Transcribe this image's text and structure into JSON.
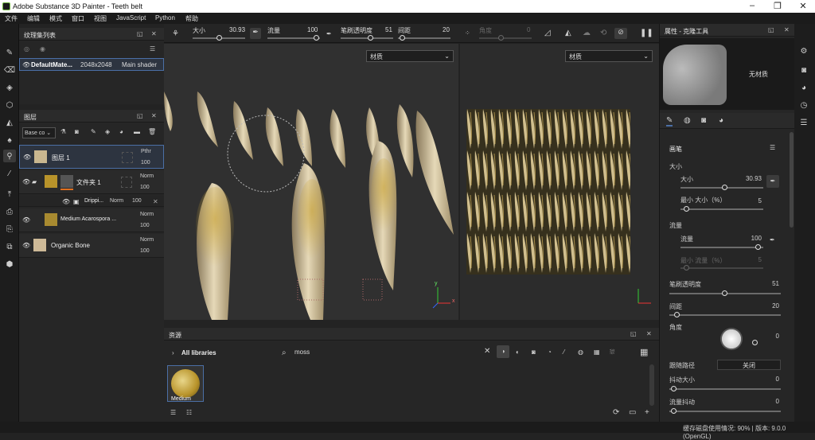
{
  "window": {
    "title": "Adobe Substance 3D Painter - Teeth belt"
  },
  "menu": [
    "文件",
    "编辑",
    "模式",
    "窗口",
    "视图",
    "JavaScript",
    "Python",
    "帮助"
  ],
  "texture_set": {
    "title": "纹理集列表",
    "item": {
      "name": "DefaultMate...",
      "res": "2048x2048",
      "shader": "Main shader"
    }
  },
  "layers": {
    "title": "图层",
    "channel": "Base co",
    "items": [
      {
        "name": "图层 1",
        "blend": "Pthr",
        "opacity": "100"
      },
      {
        "name": "文件夹 1",
        "blend": "Norm",
        "opacity": "100"
      },
      {
        "name": "Drippi...",
        "blend": "Norm",
        "opacity": "100"
      },
      {
        "name": "Medium Acarospora ...",
        "blend": "Norm",
        "opacity": "100"
      },
      {
        "name": "Organic Bone",
        "blend": "Norm",
        "opacity": "100"
      }
    ]
  },
  "toolbar": {
    "size_label": "大小",
    "size_value": "30.93",
    "flow_label": "流量",
    "flow_value": "100",
    "opacity_label": "笔刷透明度",
    "opacity_value": "51",
    "spacing_label": "间距",
    "spacing_value": "20",
    "angle_label": "角度",
    "angle_value": "0"
  },
  "viewport": {
    "left_dropdown": "材质",
    "right_dropdown": "材质",
    "axis_x": "x",
    "axis_y": "y"
  },
  "assets": {
    "title": "资源",
    "library": "All libraries",
    "search_value": "moss",
    "asset_name": "Medium"
  },
  "properties": {
    "title": "属性 - 克隆工具",
    "no_material": "无材质",
    "section_brush": "画笔",
    "size_group": "大小",
    "size": "大小",
    "size_value": "30.93",
    "min_size": "最小 大小（%）",
    "min_size_value": "5",
    "flow_group": "流量",
    "flow": "流量",
    "flow_value": "100",
    "min_flow": "最小 流量（%）",
    "min_flow_value": "5",
    "brush_opacity": "笔刷透明度",
    "brush_opacity_value": "51",
    "spacing": "间距",
    "spacing_value": "20",
    "angle": "角度",
    "angle_value": "0",
    "follow_path": "跟随路径",
    "follow_path_value": "关闭",
    "jitter_size": "抖动大小",
    "jitter_size_value": "0",
    "jitter_flow": "流量抖动",
    "jitter_flow_value": "0"
  },
  "status": {
    "text": "缓存磁盘使用情况: 90% | 版本: 9.0.0 (OpenGL)"
  },
  "colors": {
    "accent": "#4b6fa6",
    "gold": "#b8932a",
    "bone": "#d9cba7"
  }
}
